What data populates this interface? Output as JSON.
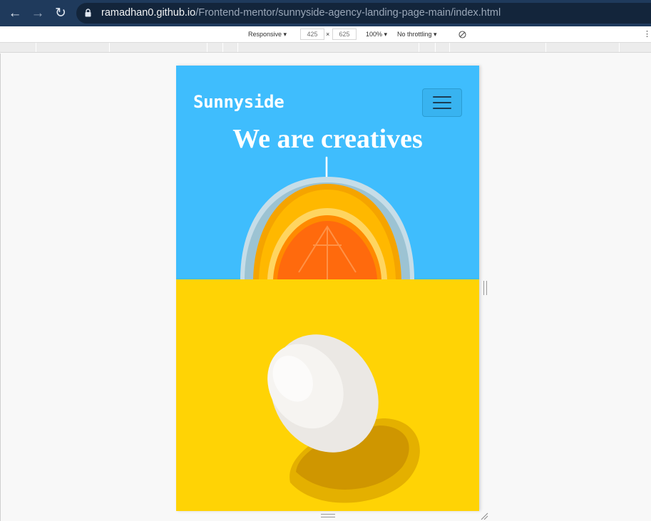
{
  "browser": {
    "back_icon": "arrow-left-icon",
    "forward_icon": "arrow-right-icon",
    "reload_icon": "reload-icon",
    "lock_icon": "lock-icon",
    "url_host": "ramadhan0.github.io",
    "url_path": "/Frontend-mentor/sunnyside-agency-landing-page-main/index.html"
  },
  "devtools": {
    "device": "Responsive",
    "width": "425",
    "times": "×",
    "height": "625",
    "zoom": "100%",
    "throttling": "No throttling",
    "rotate_icon": "rotate-icon",
    "more_icon": "more-vertical-icon"
  },
  "page": {
    "logo": "Sunnyside",
    "menu_icon": "hamburger-icon",
    "hero_title": "We are creatives",
    "arrow_icon": "arrow-down-icon",
    "colors": {
      "hero_bg": "#3fbdfd",
      "egg_bg": "#ffd305",
      "text": "#ffffff"
    }
  }
}
